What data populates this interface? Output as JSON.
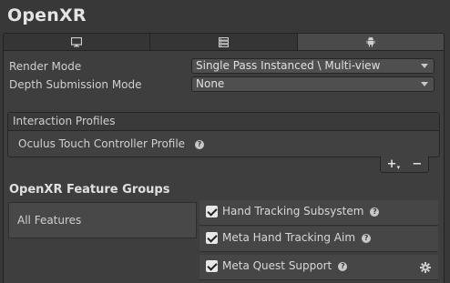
{
  "title": "OpenXR",
  "tabs": [
    {
      "icon": "monitor-icon",
      "active": false
    },
    {
      "icon": "server-icon",
      "active": false
    },
    {
      "icon": "android-icon",
      "active": true
    }
  ],
  "settings": {
    "render_mode_label": "Render Mode",
    "render_mode_value": "Single Pass Instanced \\ Multi-view",
    "depth_label": "Depth Submission Mode",
    "depth_value": "None"
  },
  "interaction_profiles": {
    "header": "Interaction Profiles",
    "items": [
      "Oculus Touch Controller Profile"
    ],
    "add_label": "+",
    "add_caret": "▾",
    "remove_label": "−"
  },
  "feature_groups": {
    "title": "OpenXR Feature Groups",
    "groups": [
      "All Features"
    ],
    "features": [
      {
        "label": "Hand Tracking Subsystem",
        "checked": true,
        "help": "?"
      },
      {
        "label": "Meta Hand Tracking Aim",
        "checked": true,
        "help": "?"
      },
      {
        "label": "Meta Quest Support",
        "checked": true,
        "help": "?",
        "settings_icon": "gear-icon"
      }
    ]
  },
  "help_glyph": "?"
}
